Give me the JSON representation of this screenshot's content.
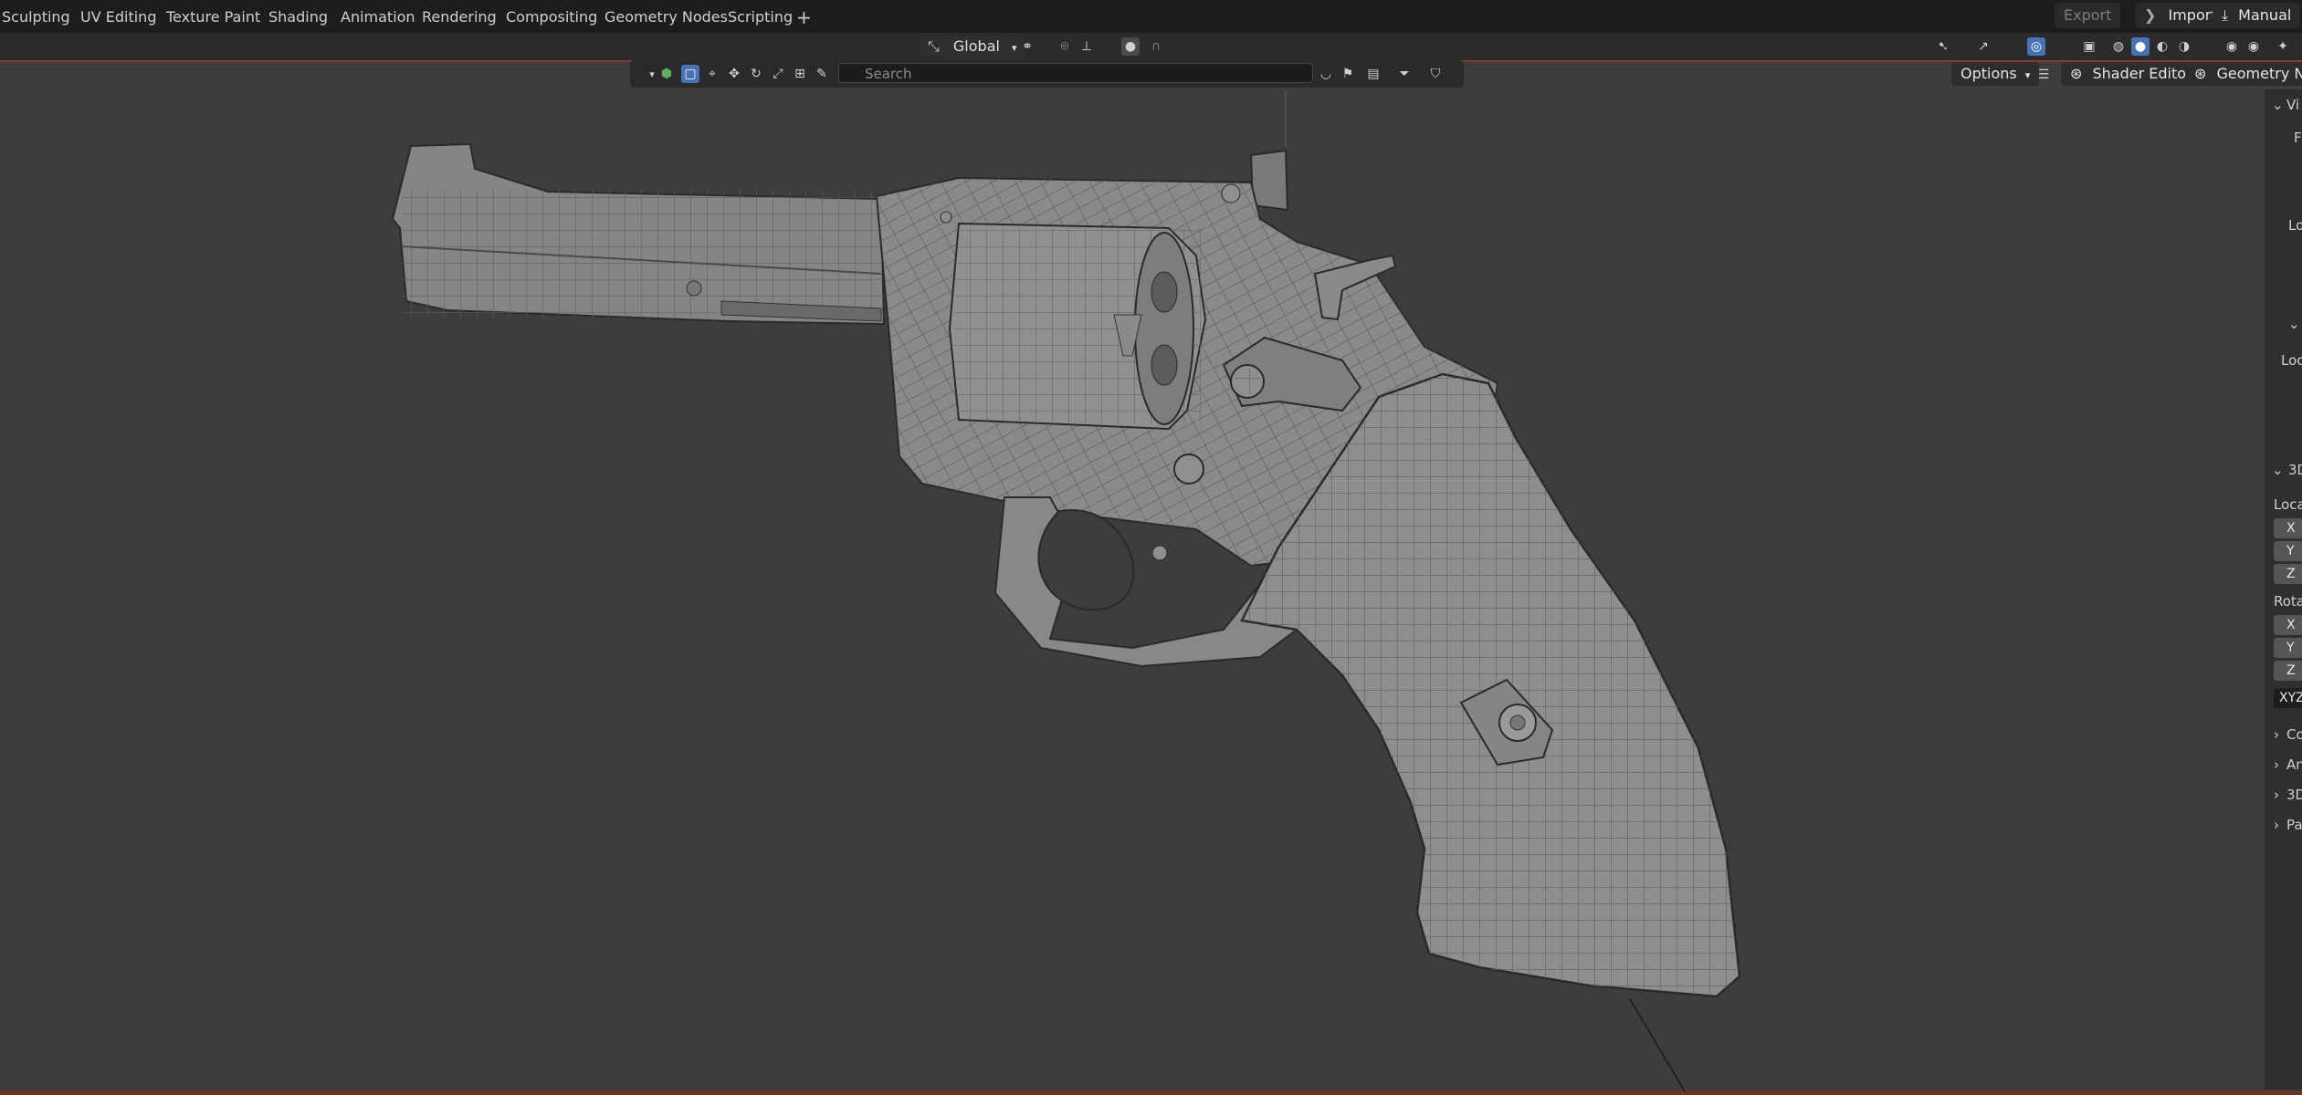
{
  "workspace_tabs": [
    "Sculpting",
    "UV Editing",
    "Texture Paint",
    "Shading",
    "Animation",
    "Rendering",
    "Compositing",
    "Geometry Nodes",
    "Scripting",
    "+"
  ],
  "topbar_right": {
    "export": "Export",
    "import": "Import",
    "manual": "Manual"
  },
  "header": {
    "transform_orientation": "Global"
  },
  "outliner": {
    "search_placeholder": "Search"
  },
  "editor_buttons": {
    "options": "Options",
    "shader_editor": "Shader Editor",
    "geometry_nodes": "Geometry Nod"
  },
  "npanel": {
    "section1": "Vi",
    "row_f": "F",
    "row_lo1": "Lo",
    "row_loc": "Loc",
    "section_3d": "3D",
    "location_label": "Loca",
    "x": "X",
    "y": "Y",
    "z": "Z",
    "rotation_label": "Rota",
    "rx": "X",
    "ry": "Y",
    "rz": "Z",
    "rot_mode": "XYZ",
    "collapsed": [
      "Co",
      "An",
      "3D",
      "Pa"
    ]
  },
  "colors": {
    "viewport_bg": "#3d3d3d",
    "accent_blue": "#4772b3",
    "header_border": "#8a3a2a"
  },
  "icons": [
    "transform-icon",
    "snap-icon",
    "proportional-icon",
    "overlay-icon",
    "shading-solid-icon",
    "filter-icon",
    "bookmark-icon",
    "search-icon",
    "import-icon",
    "manual-icon"
  ]
}
